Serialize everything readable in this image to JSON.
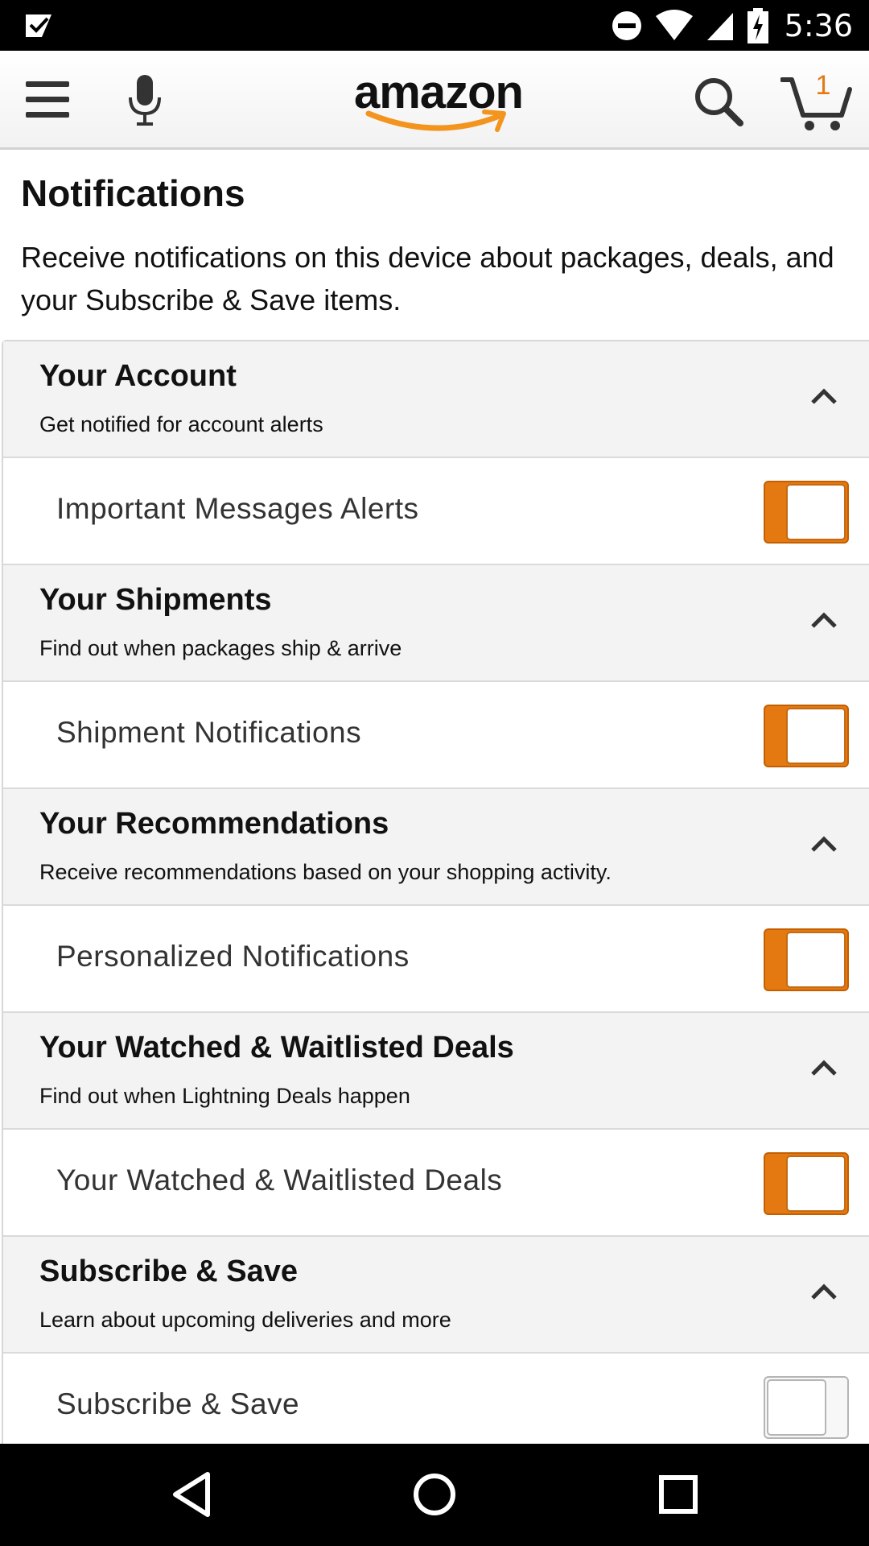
{
  "status_bar": {
    "time": "5:36",
    "icons": [
      "check-notification-icon",
      "do-not-disturb-icon",
      "wifi-icon",
      "cell-signal-icon",
      "battery-charging-icon"
    ]
  },
  "app_bar": {
    "logo_text": "amazon",
    "cart_count": "1",
    "icons": [
      "menu-icon",
      "microphone-icon",
      "search-icon",
      "cart-icon"
    ],
    "brand_color": "#e47911"
  },
  "page": {
    "title": "Notifications",
    "description": "Receive notifications on this device about packages, deals, and your Subscribe & Save items."
  },
  "sections": [
    {
      "title": "Your Account",
      "subtitle": "Get notified for account alerts",
      "expanded": true,
      "row_label": "Important Messages Alerts",
      "toggle_on": true
    },
    {
      "title": "Your Shipments",
      "subtitle": "Find out when packages ship & arrive",
      "expanded": true,
      "row_label": "Shipment Notifications",
      "toggle_on": true
    },
    {
      "title": "Your Recommendations",
      "subtitle": "Receive recommendations based on your shopping activity.",
      "expanded": true,
      "row_label": "Personalized Notifications",
      "toggle_on": true
    },
    {
      "title": "Your Watched & Waitlisted Deals",
      "subtitle": "Find out when Lightning Deals happen",
      "expanded": true,
      "row_label": "Your Watched & Waitlisted Deals",
      "toggle_on": true
    },
    {
      "title": "Subscribe & Save",
      "subtitle": "Learn about upcoming deliveries and more",
      "expanded": true,
      "row_label": "Subscribe & Save",
      "toggle_on": false
    }
  ],
  "nav_bar": {
    "icons": [
      "back-icon",
      "home-icon",
      "recents-icon"
    ]
  }
}
